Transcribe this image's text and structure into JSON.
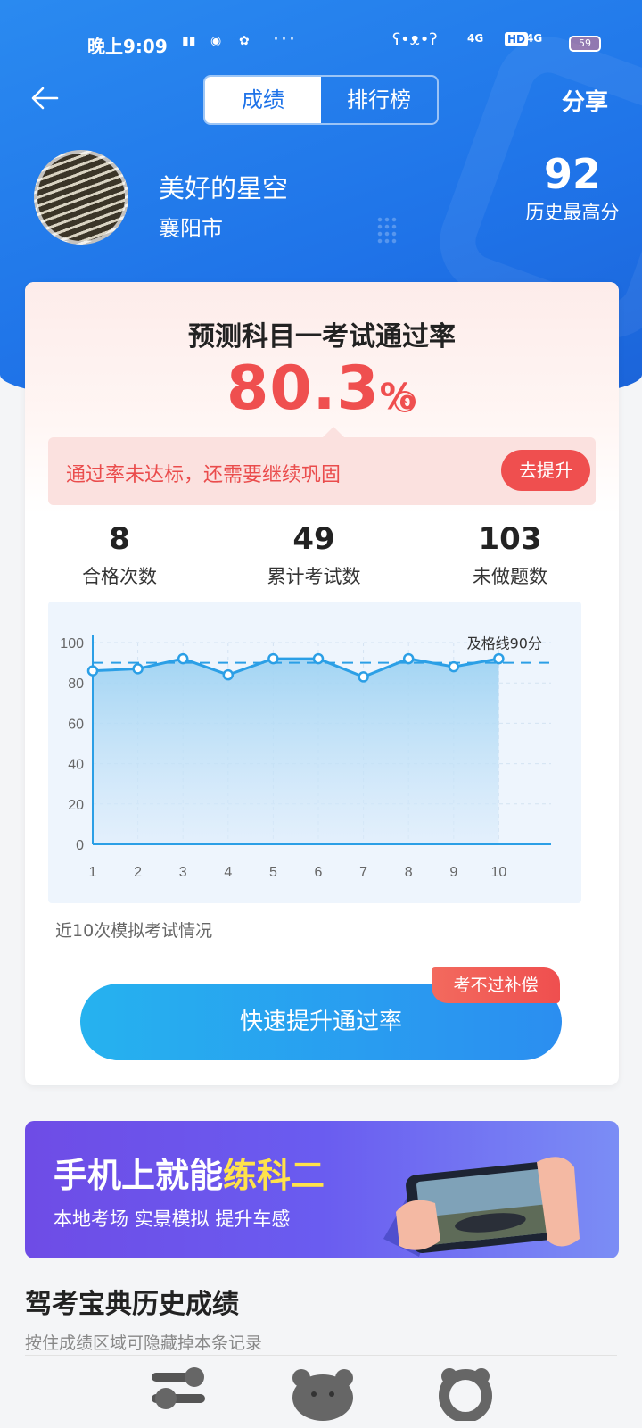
{
  "status_bar": {
    "time": "晚上9:09",
    "network_1": "4G",
    "hd": "HD",
    "network_2": "4G",
    "battery": "59"
  },
  "nav": {
    "tabs": [
      "成绩",
      "排行榜"
    ],
    "active_tab": "成绩",
    "share_label": "分享"
  },
  "profile": {
    "name": "美好的星空",
    "city": "襄阳市",
    "best_score": "92",
    "best_score_label": "历史最高分"
  },
  "prediction": {
    "title": "预测科目一考试通过率",
    "value": "80.3",
    "unit": "%",
    "warning": "通过率未达标，还需要继续巩固",
    "improve_button": "去提升"
  },
  "stats": [
    {
      "value": "8",
      "label": "合格次数"
    },
    {
      "value": "49",
      "label": "累计考试数"
    },
    {
      "value": "103",
      "label": "未做题数"
    }
  ],
  "chart_data": {
    "type": "area",
    "x": [
      1,
      2,
      3,
      4,
      5,
      6,
      7,
      8,
      9,
      10
    ],
    "values": [
      86,
      87,
      92,
      84,
      92,
      92,
      83,
      92,
      88,
      92
    ],
    "y_ticks": [
      0,
      20,
      40,
      60,
      80,
      100
    ],
    "ylim": [
      0,
      100
    ],
    "reference_line": {
      "value": 90,
      "label": "及格线90分"
    },
    "grid": true,
    "color": "#2b9fe6"
  },
  "chart_caption": "近10次模拟考试情况",
  "cta": {
    "label": "快速提升通过率",
    "badge": "考不过补偿"
  },
  "banner": {
    "title_main": "手机上就能",
    "title_highlight": "练科二",
    "subtitle": "本地考场  实景模拟  提升车感"
  },
  "history": {
    "title": "驾考宝典历史成绩",
    "hint": "按住成绩区域可隐藏掉本条记录"
  },
  "colors": {
    "primary": "#1f73e8",
    "accent_red": "#ef4f4f",
    "chart_line": "#2b9fe6"
  }
}
